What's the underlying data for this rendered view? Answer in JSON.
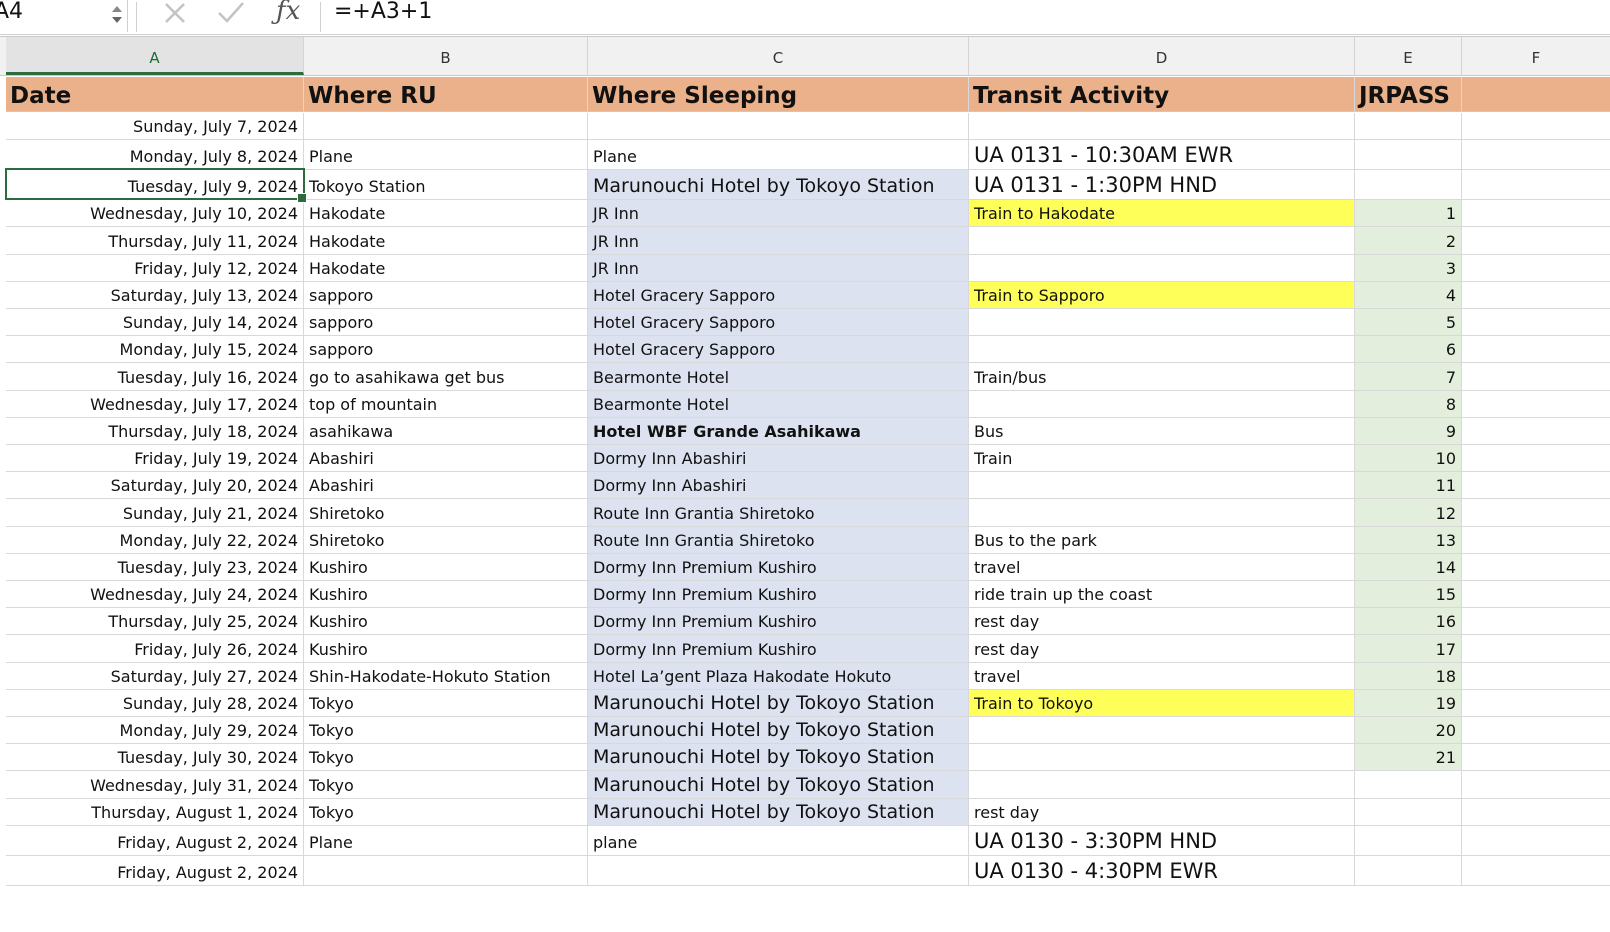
{
  "formula_bar": {
    "namebox": "A4",
    "formula": "=+A3+1"
  },
  "columns": [
    "A",
    "B",
    "C",
    "D",
    "E",
    "F"
  ],
  "headers": {
    "a": "Date",
    "b": "Where RU",
    "c": "Where Sleeping",
    "d": "Transit Activity",
    "e": "JRPASS"
  },
  "colors": {
    "header": "#ebb18a",
    "sleeping": "#dce2f0",
    "highlight": "#ffff5a",
    "jrpass": "#e3eedc",
    "selection": "#2c6b3f"
  },
  "rows": [
    {
      "a": "Sunday, July 7, 2024",
      "b": "",
      "c": "",
      "d": "",
      "e": ""
    },
    {
      "a": "Monday, July 8, 2024",
      "b": "Plane",
      "c": "Plane",
      "d": "UA 0131 - 10:30AM EWR",
      "e": ""
    },
    {
      "a": "Tuesday, July 9, 2024",
      "b": "Tokoyo Station",
      "c": "Marunouchi Hotel by Tokoyo Station",
      "d": "UA 0131 - 1:30PM  HND",
      "e": ""
    },
    {
      "a": "Wednesday, July 10, 2024",
      "b": "Hakodate",
      "c": "JR Inn",
      "d": "Train to Hakodate",
      "e": "1"
    },
    {
      "a": "Thursday, July 11, 2024",
      "b": "Hakodate",
      "c": "JR Inn",
      "d": "",
      "e": "2"
    },
    {
      "a": "Friday, July 12, 2024",
      "b": "Hakodate",
      "c": "JR Inn",
      "d": "",
      "e": "3"
    },
    {
      "a": "Saturday, July 13, 2024",
      "b": "sapporo",
      "c": "Hotel Gracery Sapporo",
      "d": "Train to Sapporo",
      "e": "4"
    },
    {
      "a": "Sunday, July 14, 2024",
      "b": "sapporo",
      "c": "Hotel Gracery Sapporo",
      "d": "",
      "e": "5"
    },
    {
      "a": "Monday, July 15, 2024",
      "b": "sapporo",
      "c": "Hotel Gracery Sapporo",
      "d": "",
      "e": "6"
    },
    {
      "a": "Tuesday, July 16, 2024",
      "b": "go to asahikawa get bus",
      "c": "Bearmonte Hotel",
      "d": "Train/bus",
      "e": "7"
    },
    {
      "a": "Wednesday, July 17, 2024",
      "b": "top of mountain",
      "c": "Bearmonte Hotel",
      "d": "",
      "e": "8"
    },
    {
      "a": "Thursday, July 18, 2024",
      "b": "asahikawa",
      "c": "Hotel WBF Grande Asahikawa",
      "d": "Bus",
      "e": "9"
    },
    {
      "a": "Friday, July 19, 2024",
      "b": "Abashiri",
      "c": "Dormy Inn Abashiri",
      "d": "Train",
      "e": "10"
    },
    {
      "a": "Saturday, July 20, 2024",
      "b": "Abashiri",
      "c": "Dormy Inn Abashiri",
      "d": "",
      "e": "11"
    },
    {
      "a": "Sunday, July 21, 2024",
      "b": "Shiretoko",
      "c": "Route Inn Grantia Shiretoko",
      "d": "",
      "e": "12"
    },
    {
      "a": "Monday, July 22, 2024",
      "b": "Shiretoko",
      "c": "Route Inn Grantia Shiretoko",
      "d": "Bus to the park",
      "e": "13"
    },
    {
      "a": "Tuesday, July 23, 2024",
      "b": "Kushiro",
      "c": "Dormy Inn Premium Kushiro",
      "d": "travel",
      "e": "14"
    },
    {
      "a": "Wednesday, July 24, 2024",
      "b": "Kushiro",
      "c": "Dormy Inn Premium Kushiro",
      "d": "ride train up the coast",
      "e": "15"
    },
    {
      "a": "Thursday, July 25, 2024",
      "b": "Kushiro",
      "c": "Dormy Inn Premium Kushiro",
      "d": "rest day",
      "e": "16"
    },
    {
      "a": "Friday, July 26, 2024",
      "b": "Kushiro",
      "c": "Dormy Inn Premium Kushiro",
      "d": "rest day",
      "e": "17"
    },
    {
      "a": "Saturday, July 27, 2024",
      "b": "Shin-Hakodate-Hokuto Station",
      "c": "Hotel La’gent Plaza Hakodate Hokuto",
      "d": "travel",
      "e": "18"
    },
    {
      "a": "Sunday, July 28, 2024",
      "b": "Tokyo",
      "c": "Marunouchi Hotel by Tokoyo Station",
      "d": "Train to Tokoyo",
      "e": "19"
    },
    {
      "a": "Monday, July 29, 2024",
      "b": "Tokyo",
      "c": "Marunouchi Hotel by Tokoyo Station",
      "d": "",
      "e": "20"
    },
    {
      "a": "Tuesday, July 30, 2024",
      "b": "Tokyo",
      "c": "Marunouchi Hotel by Tokoyo Station",
      "d": "",
      "e": "21"
    },
    {
      "a": "Wednesday, July 31, 2024",
      "b": "Tokyo",
      "c": "Marunouchi Hotel by Tokoyo Station",
      "d": "",
      "e": ""
    },
    {
      "a": "Thursday, August 1, 2024",
      "b": "Tokyo",
      "c": "Marunouchi Hotel by Tokoyo Station",
      "d": "rest day",
      "e": ""
    },
    {
      "a": "Friday, August 2, 2024",
      "b": "Plane",
      "c": "plane",
      "d": "UA 0130 - 3:30PM HND",
      "e": ""
    },
    {
      "a": "Friday, August 2, 2024",
      "b": "",
      "c": "",
      "d": "UA 0130 - 4:30PM EWR",
      "e": ""
    }
  ]
}
